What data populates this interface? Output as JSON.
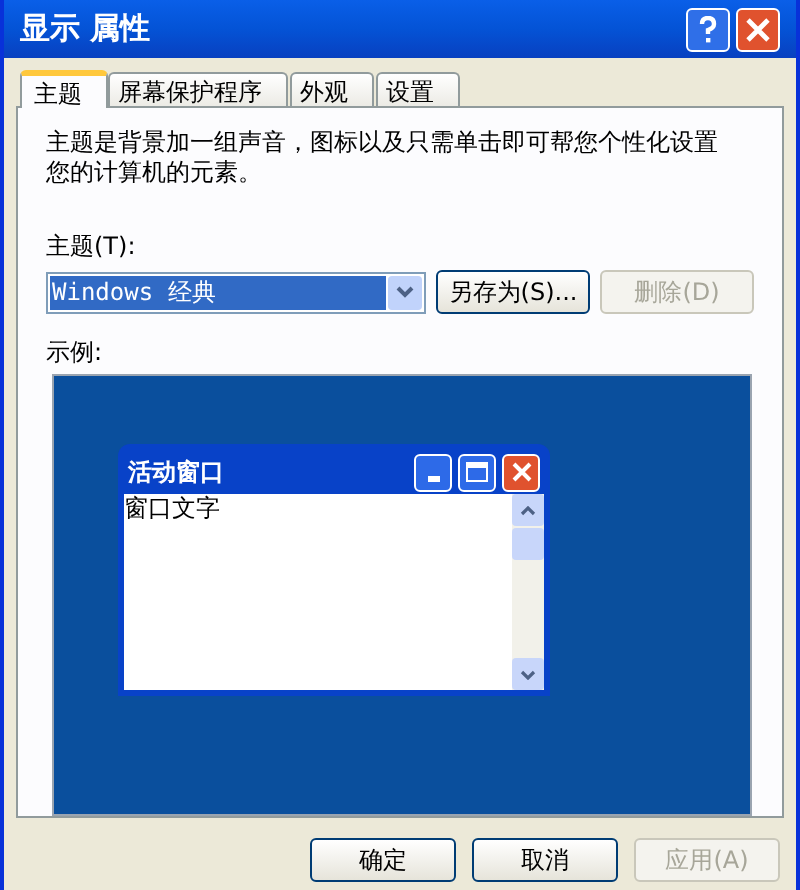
{
  "window": {
    "title": "显示 属性"
  },
  "tabs": [
    {
      "label": "主题",
      "selected": true
    },
    {
      "label": "屏幕保护程序",
      "selected": false
    },
    {
      "label": "外观",
      "selected": false
    },
    {
      "label": "设置",
      "selected": false
    }
  ],
  "description": "主题是背景加一组声音，图标以及只需单击即可帮您个性化设置您的计算机的元素。",
  "theme_label": "主题(T):",
  "theme_select": {
    "value": "Windows 经典"
  },
  "theme_buttons": [
    {
      "label": "另存为(S)...",
      "disabled": false
    },
    {
      "label": "删除(D)",
      "disabled": true
    }
  ],
  "preview": {
    "label": "示例:",
    "window_title": "活动窗口",
    "window_text": "窗口文字"
  },
  "buttons": [
    {
      "label": "确定",
      "disabled": false
    },
    {
      "label": "取消",
      "disabled": false
    },
    {
      "label": "应用(A)",
      "disabled": true
    }
  ]
}
